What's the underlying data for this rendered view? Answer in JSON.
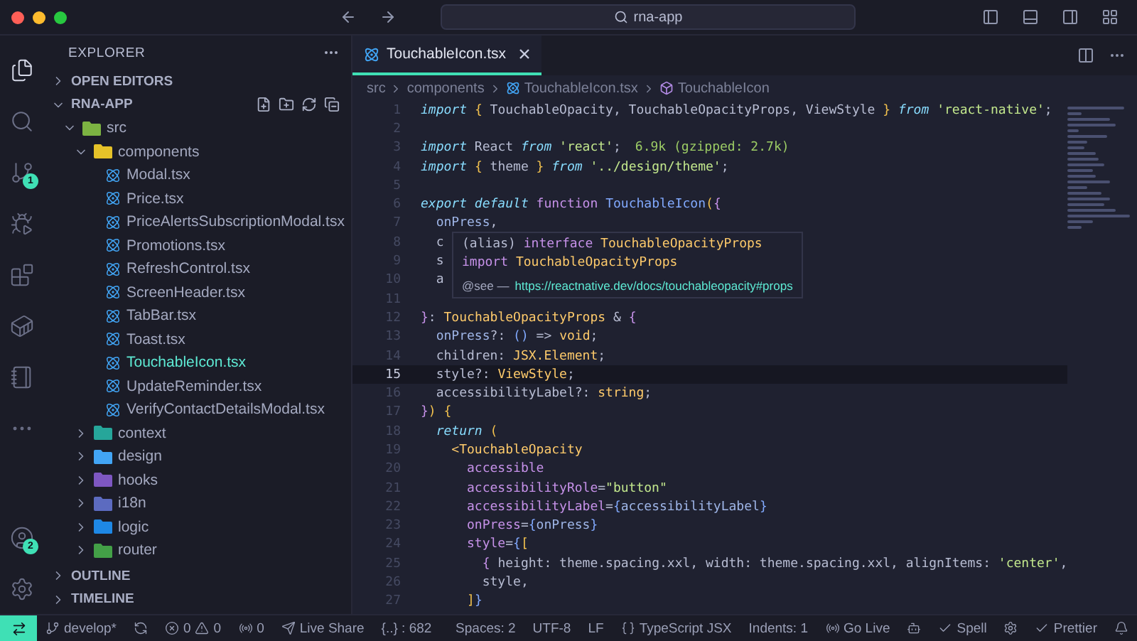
{
  "title_bar": {
    "search": "rna-app"
  },
  "activity_bar": {
    "items": [
      {
        "kind": "explorer",
        "selected": true
      },
      {
        "kind": "search",
        "selected": false
      },
      {
        "kind": "source-control",
        "selected": false,
        "badge": "1"
      },
      {
        "kind": "run",
        "selected": false
      },
      {
        "kind": "extensions",
        "selected": false
      },
      {
        "kind": "docker",
        "selected": false
      },
      {
        "kind": "notebook",
        "selected": false
      },
      {
        "kind": "more",
        "selected": false
      }
    ],
    "bottom": [
      {
        "kind": "accounts",
        "badge": "2"
      },
      {
        "kind": "manage"
      }
    ]
  },
  "sidebar": {
    "title": "EXPLORER",
    "sections": [
      {
        "label": "OPEN EDITORS",
        "expanded": false
      },
      {
        "label": "RNA-APP",
        "expanded": true
      }
    ],
    "tree": [
      {
        "label": "src",
        "kind": "folder",
        "expanded": true,
        "color": "#7cb342",
        "children": [
          {
            "label": "components",
            "kind": "folder",
            "expanded": true,
            "color": "#e6c229",
            "children": [
              {
                "label": "Modal.tsx",
                "kind": "file",
                "selected": false
              },
              {
                "label": "Price.tsx",
                "kind": "file",
                "selected": false
              },
              {
                "label": "PriceAlertsSubscriptionModal.tsx",
                "kind": "file",
                "selected": false
              },
              {
                "label": "Promotions.tsx",
                "kind": "file",
                "selected": false
              },
              {
                "label": "RefreshControl.tsx",
                "kind": "file",
                "selected": false
              },
              {
                "label": "ScreenHeader.tsx",
                "kind": "file",
                "selected": false
              },
              {
                "label": "TabBar.tsx",
                "kind": "file",
                "selected": false
              },
              {
                "label": "Toast.tsx",
                "kind": "file",
                "selected": false
              },
              {
                "label": "TouchableIcon.tsx",
                "kind": "file",
                "selected": true
              },
              {
                "label": "UpdateReminder.tsx",
                "kind": "file",
                "selected": false
              },
              {
                "label": "VerifyContactDetailsModal.tsx",
                "kind": "file",
                "selected": false
              }
            ]
          },
          {
            "label": "context",
            "kind": "folder",
            "expanded": false,
            "color": "#26a69a"
          },
          {
            "label": "design",
            "kind": "folder",
            "expanded": false,
            "color": "#42a5f5"
          },
          {
            "label": "hooks",
            "kind": "folder",
            "expanded": false,
            "color": "#7e57c2"
          },
          {
            "label": "i18n",
            "kind": "folder",
            "expanded": false,
            "color": "#5c6bc0"
          },
          {
            "label": "logic",
            "kind": "folder",
            "expanded": false,
            "color": "#1e88e5"
          },
          {
            "label": "router",
            "kind": "folder",
            "expanded": false,
            "color": "#43a047"
          }
        ]
      }
    ],
    "bottom_sections": [
      {
        "label": "OUTLINE",
        "expanded": false
      },
      {
        "label": "TIMELINE",
        "expanded": false
      }
    ]
  },
  "editor": {
    "tabs": [
      {
        "label": "TouchableIcon.tsx",
        "selected": true
      }
    ],
    "breadcrumbs": [
      {
        "label": "src",
        "kind": "folder"
      },
      {
        "label": "components",
        "kind": "folder"
      },
      {
        "label": "TouchableIcon.tsx",
        "kind": "file"
      },
      {
        "label": "TouchableIcon",
        "kind": "symbol"
      }
    ],
    "lines": [
      {
        "number": "1",
        "current": false,
        "tokens": [
          {
            "kind": "kw",
            "t": "import "
          },
          {
            "kind": "br",
            "t": "{"
          },
          {
            "kind": "p",
            "t": " TouchableOpacity, TouchableOpacityProps, ViewStyle "
          },
          {
            "kind": "br",
            "t": "}"
          },
          {
            "kind": "kw",
            "t": " from "
          },
          {
            "kind": "str",
            "t": "'react-native'"
          },
          {
            "kind": "p",
            "t": ";"
          }
        ]
      },
      {
        "number": "2",
        "current": false
      },
      {
        "number": "3",
        "current": false,
        "tokens": [
          {
            "kind": "kw",
            "t": "import"
          },
          {
            "kind": "p",
            "t": " React "
          },
          {
            "kind": "kw",
            "t": "from "
          },
          {
            "kind": "str",
            "t": "'react'"
          },
          {
            "kind": "p",
            "t": ";"
          }
        ],
        "hint": "6.9k (gzipped: 2.7k)"
      },
      {
        "number": "4",
        "current": false,
        "tokens": [
          {
            "kind": "kw",
            "t": "import "
          },
          {
            "kind": "br",
            "t": "{"
          },
          {
            "kind": "p",
            "t": " theme "
          },
          {
            "kind": "br",
            "t": "}"
          },
          {
            "kind": "kw",
            "t": " from "
          },
          {
            "kind": "str",
            "t": "'../design/theme'"
          },
          {
            "kind": "p",
            "t": ";"
          }
        ]
      },
      {
        "number": "5",
        "current": false
      },
      {
        "number": "6",
        "current": false,
        "tokens": [
          {
            "kind": "kw",
            "t": "export default "
          },
          {
            "kind": "attr",
            "t": "function "
          },
          {
            "kind": "fn",
            "t": "TouchableIcon"
          },
          {
            "kind": "br",
            "t": "("
          },
          {
            "kind": "attr",
            "t": "{"
          }
        ]
      },
      {
        "number": "7",
        "current": false,
        "tokens": [
          {
            "kind": "var",
            "t": "  onPress"
          },
          {
            "kind": "p",
            "t": ","
          }
        ]
      },
      {
        "number": "8",
        "current": false,
        "tokens": [
          {
            "kind": "p",
            "t": "  c"
          }
        ]
      },
      {
        "number": "9",
        "current": false,
        "tokens": [
          {
            "kind": "p",
            "t": "  s"
          }
        ]
      },
      {
        "number": "10",
        "current": false,
        "tokens": [
          {
            "kind": "p",
            "t": "  a"
          }
        ]
      },
      {
        "number": "11",
        "current": false
      },
      {
        "number": "12",
        "current": false,
        "tokens": [
          {
            "kind": "attr",
            "t": "}"
          },
          {
            "kind": "p",
            "t": ": "
          },
          {
            "kind": "type",
            "t": "TouchableOpacityProps"
          },
          {
            "kind": "p",
            "t": " & "
          },
          {
            "kind": "attr",
            "t": "{"
          }
        ]
      },
      {
        "number": "13",
        "current": false,
        "tokens": [
          {
            "kind": "var",
            "t": "  onPress"
          },
          {
            "kind": "p",
            "t": "?: "
          },
          {
            "kind": "fn",
            "t": "()"
          },
          {
            "kind": "p",
            "t": " => "
          },
          {
            "kind": "type",
            "t": "void"
          },
          {
            "kind": "p",
            "t": ";"
          }
        ]
      },
      {
        "number": "14",
        "current": false,
        "tokens": [
          {
            "kind": "p",
            "t": "  children: "
          },
          {
            "kind": "type",
            "t": "JSX.Element"
          },
          {
            "kind": "p",
            "t": ";"
          }
        ]
      },
      {
        "number": "15",
        "current": true,
        "tokens": [
          {
            "kind": "p",
            "t": "  style?: "
          },
          {
            "kind": "type",
            "t": "ViewStyle"
          },
          {
            "kind": "p",
            "t": ";"
          }
        ]
      },
      {
        "number": "16",
        "current": false,
        "tokens": [
          {
            "kind": "p",
            "t": "  accessibilityLabel?: "
          },
          {
            "kind": "type",
            "t": "string"
          },
          {
            "kind": "p",
            "t": ";"
          }
        ]
      },
      {
        "number": "17",
        "current": false,
        "tokens": [
          {
            "kind": "attr",
            "t": "}"
          },
          {
            "kind": "br",
            "t": ") {"
          }
        ]
      },
      {
        "number": "18",
        "current": false,
        "tokens": [
          {
            "kind": "kw",
            "t": "  return "
          },
          {
            "kind": "br",
            "t": "("
          }
        ]
      },
      {
        "number": "19",
        "current": false,
        "tokens": [
          {
            "kind": "type",
            "t": "    <TouchableOpacity"
          }
        ]
      },
      {
        "number": "20",
        "current": false,
        "tokens": [
          {
            "kind": "attr",
            "t": "      accessible"
          }
        ]
      },
      {
        "number": "21",
        "current": false,
        "tokens": [
          {
            "kind": "attr",
            "t": "      accessibilityRole"
          },
          {
            "kind": "p",
            "t": "="
          },
          {
            "kind": "str",
            "t": "\"button\""
          }
        ]
      },
      {
        "number": "22",
        "current": false,
        "tokens": [
          {
            "kind": "attr",
            "t": "      accessibilityLabel"
          },
          {
            "kind": "p",
            "t": "="
          },
          {
            "kind": "fn",
            "t": "{"
          },
          {
            "kind": "var",
            "t": "accessibilityLabel"
          },
          {
            "kind": "fn",
            "t": "}"
          }
        ]
      },
      {
        "number": "23",
        "current": false,
        "tokens": [
          {
            "kind": "attr",
            "t": "      onPress"
          },
          {
            "kind": "p",
            "t": "="
          },
          {
            "kind": "fn",
            "t": "{"
          },
          {
            "kind": "var",
            "t": "onPress"
          },
          {
            "kind": "fn",
            "t": "}"
          }
        ]
      },
      {
        "number": "24",
        "current": false,
        "tokens": [
          {
            "kind": "attr",
            "t": "      style"
          },
          {
            "kind": "p",
            "t": "="
          },
          {
            "kind": "fn",
            "t": "{"
          },
          {
            "kind": "br",
            "t": "["
          }
        ]
      },
      {
        "number": "25",
        "current": false,
        "tokens": [
          {
            "kind": "attr",
            "t": "        {"
          },
          {
            "kind": "p",
            "t": " height: theme.spacing.xxl, width: theme.spacing.xxl, alignItems: "
          },
          {
            "kind": "str",
            "t": "'center'"
          },
          {
            "kind": "p",
            "t": ","
          }
        ]
      },
      {
        "number": "26",
        "current": false,
        "tokens": [
          {
            "kind": "p",
            "t": "        style,"
          }
        ]
      },
      {
        "number": "27",
        "current": false,
        "tokens": [
          {
            "kind": "br",
            "t": "      ]"
          },
          {
            "kind": "fn",
            "t": "}"
          }
        ]
      }
    ],
    "hover": {
      "lines": [
        [
          {
            "kind": "p",
            "t": "(alias) "
          },
          {
            "kind": "attr",
            "t": "interface "
          },
          {
            "kind": "type",
            "t": "TouchableOpacityProps"
          }
        ],
        [
          {
            "kind": "attr",
            "t": "import "
          },
          {
            "kind": "type",
            "t": "TouchableOpacityProps"
          }
        ]
      ],
      "see": "@see —",
      "link": "https://reactnative.dev/docs/touchableopacity#props"
    }
  },
  "status_bar": {
    "left": [
      {
        "kind": "remote"
      },
      {
        "kind": "branch",
        "text": "develop*"
      },
      {
        "kind": "sync"
      },
      {
        "kind": "problems",
        "errors": "0",
        "warnings": "0"
      },
      {
        "kind": "ports",
        "text": "0"
      },
      {
        "kind": "live-share",
        "text": "Live Share"
      },
      {
        "kind": "text",
        "text": "{..} : 682"
      }
    ],
    "right": [
      {
        "kind": "text",
        "text": "Spaces: 2"
      },
      {
        "kind": "text",
        "text": "UTF-8"
      },
      {
        "kind": "text",
        "text": "LF"
      },
      {
        "kind": "language",
        "text": "TypeScript JSX"
      },
      {
        "kind": "text",
        "text": "Indents: 1"
      },
      {
        "kind": "go-live",
        "text": "Go Live"
      },
      {
        "kind": "copilot"
      },
      {
        "kind": "spell",
        "text": "Spell"
      },
      {
        "kind": "settings"
      },
      {
        "kind": "prettier",
        "text": "Prettier"
      },
      {
        "kind": "notifications"
      }
    ]
  }
}
